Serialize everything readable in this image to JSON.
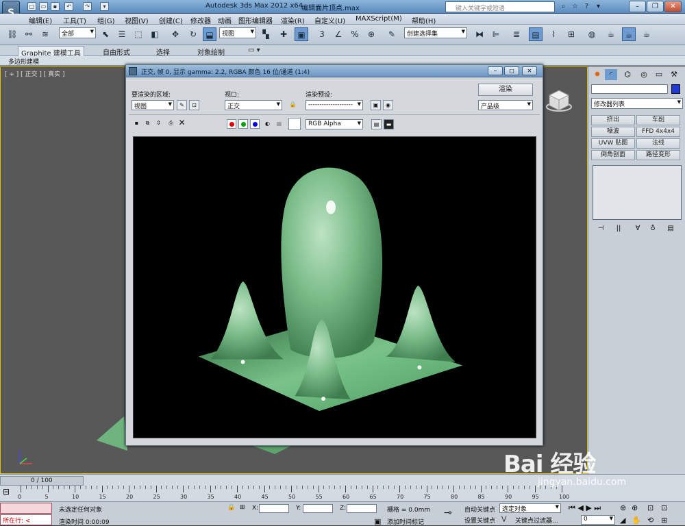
{
  "titlebar": {
    "app_title": "Autodesk 3ds Max  2012 x64",
    "file_title": "编辑面片顶点.max",
    "search_placeholder": "键入关键字或短语",
    "quick_access": [
      "new-icon",
      "open-icon",
      "save-icon",
      "undo-icon",
      "redo-icon",
      "dropdown-icon"
    ],
    "window_buttons": {
      "minimize": "–",
      "restore": "❐",
      "close": "✕"
    }
  },
  "menu": [
    "编辑(E)",
    "工具(T)",
    "组(G)",
    "视图(V)",
    "创建(C)",
    "修改器",
    "动画",
    "图形编辑器",
    "渲染(R)",
    "自定义(U)",
    "MAXScript(M)",
    "帮助(H)"
  ],
  "toolbar": {
    "selection_filter": "全部",
    "ref_coord": "视图",
    "named_selection": "创建选择集"
  },
  "ribbon": {
    "tabs": [
      "Graphite 建模工具",
      "自由形式",
      "选择",
      "对象绘制"
    ],
    "subtab": "多边形建模"
  },
  "viewport": {
    "label": "[ + ] [ 正交 ] [ 真实 ]"
  },
  "render_dialog": {
    "title": "正交, 帧 0, 显示 gamma: 2.2, RGBA 颜色 16 位/通道 (1:4)",
    "area_label": "要渲染的区域:",
    "area_value": "视图",
    "viewport_label": "视口:",
    "viewport_value": "正交",
    "preset_label": "渲染预设:",
    "preset_value": "--------------------",
    "render_button": "渲染",
    "quality_value": "产品级",
    "channel_value": "RGB Alpha",
    "channel_colors": {
      "red": "#e00000",
      "green": "#00a000",
      "blue": "#0000e0"
    },
    "render_colors": {
      "material": "#6fb47f",
      "highlight": "#e8f4ea",
      "background": "#000000"
    }
  },
  "command_panel": {
    "tabs": [
      "create-icon",
      "modify-icon",
      "hierarchy-icon",
      "motion-icon",
      "display-icon",
      "utilities-icon"
    ],
    "modifier_list": "修改器列表",
    "modifier_buttons": [
      "挤出",
      "车削",
      "噪波",
      "FFD 4x4x4",
      "UVW 贴图",
      "法线",
      "倒角剖面",
      "路径变形"
    ],
    "object_color": "#1e3ad2"
  },
  "timeline": {
    "frame_display": "0 / 100",
    "ticks": [
      "0",
      "5",
      "10",
      "15",
      "20",
      "25",
      "30",
      "35",
      "40",
      "45",
      "50",
      "55",
      "60",
      "65",
      "70",
      "75",
      "80",
      "85",
      "90",
      "95",
      "100"
    ]
  },
  "status": {
    "maxscript_listener": "所在行: <",
    "selection_status": "未选定任何对象",
    "render_time": "渲染时间  0:00:09",
    "x_label": "X:",
    "y_label": "Y:",
    "z_label": "Z:",
    "grid": "栅格 = 0.0mm",
    "add_time_tag": "添加时间标记",
    "auto_key": "自动关键点",
    "set_key": "设置关键点",
    "selected_object": "选定对象",
    "key_filters": "关键点过滤器...",
    "frame_value": "0"
  },
  "watermark": {
    "logo": "Bai 经验",
    "url": "jingyan.baidu.com"
  }
}
